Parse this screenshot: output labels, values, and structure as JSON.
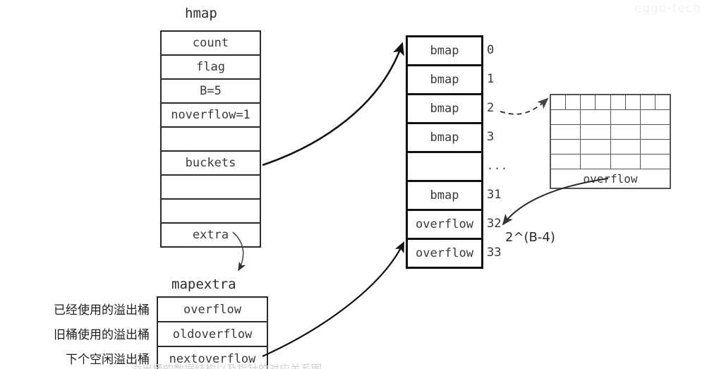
{
  "diagram": {
    "title_hmap": "hmap",
    "title_mapextra": "mapextra",
    "watermark": "eggo-tech",
    "pow_label": "2^(B-4)",
    "bottom_cut_text": "溢出桶的数据结构以及指针的对应关系图"
  },
  "hmap": {
    "rows": [
      {
        "label": "count"
      },
      {
        "label": "flag"
      },
      {
        "label": "B=5"
      },
      {
        "label": "noverflow=1"
      },
      {
        "label": ""
      },
      {
        "label": "buckets"
      },
      {
        "label": ""
      },
      {
        "label": ""
      },
      {
        "label": "extra"
      }
    ]
  },
  "bmap": {
    "rows": [
      {
        "label": "bmap",
        "index": "0"
      },
      {
        "label": "bmap",
        "index": "1"
      },
      {
        "label": "bmap",
        "index": "2"
      },
      {
        "label": "bmap",
        "index": "3"
      },
      {
        "label": "",
        "index": "..."
      },
      {
        "label": "bmap",
        "index": "31"
      },
      {
        "label": "overflow",
        "index": "32"
      },
      {
        "label": "overflow",
        "index": "33"
      }
    ]
  },
  "mapextra": {
    "rows": [
      {
        "annotation": "已经使用的溢出桶",
        "label": "overflow"
      },
      {
        "annotation": "旧桶使用的溢出桶",
        "label": "oldoverflow"
      },
      {
        "annotation": "下个空闲溢出桶",
        "label": "nextoverflow"
      }
    ]
  },
  "overflow_grid": {
    "top_row_cells": 8,
    "body_rows": 4,
    "body_cols": 4,
    "footer_label": "overflow"
  },
  "colors": {
    "ink": "#2b2b2b",
    "bold_ink": "#111111",
    "grid_line": "#555555",
    "text": "#3a3a3a",
    "background": "#ffffff"
  }
}
